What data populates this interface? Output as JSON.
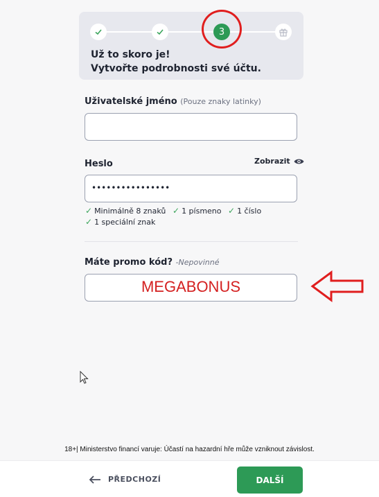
{
  "stepper": {
    "steps": [
      {
        "state": "done",
        "icon": "check-icon"
      },
      {
        "state": "done",
        "icon": "check-icon"
      },
      {
        "state": "current",
        "label": "3"
      },
      {
        "state": "upcoming",
        "icon": "gift-icon"
      }
    ],
    "heading_line1": "Už to skoro je!",
    "heading_line2": "Vytvořte podrobnosti své účtu."
  },
  "username": {
    "label": "Uživatelské jméno",
    "hint": "(Pouze znaky latinky)",
    "value": ""
  },
  "password": {
    "label": "Heslo",
    "show_label": "Zobrazit",
    "value_masked": "••••••••••••••••",
    "requirements": [
      "Minimálně 8 znaků",
      "1 písmeno",
      "1 číslo",
      "1 speciální znak"
    ]
  },
  "promo": {
    "label": "Máte promo kód?",
    "hint": "-Nepovinné",
    "value": "MEGABONUS"
  },
  "warning_text": "18+| Ministerstvo financí varuje: Účastí na hazardní hře může vzniknout závislost.",
  "footer": {
    "back_label": "PŘEDCHOZÍ",
    "next_label": "DALŠÍ"
  },
  "colors": {
    "accent_green": "#2d9a56",
    "annotation_red": "#e01e1e",
    "promo_text": "#d42020"
  }
}
